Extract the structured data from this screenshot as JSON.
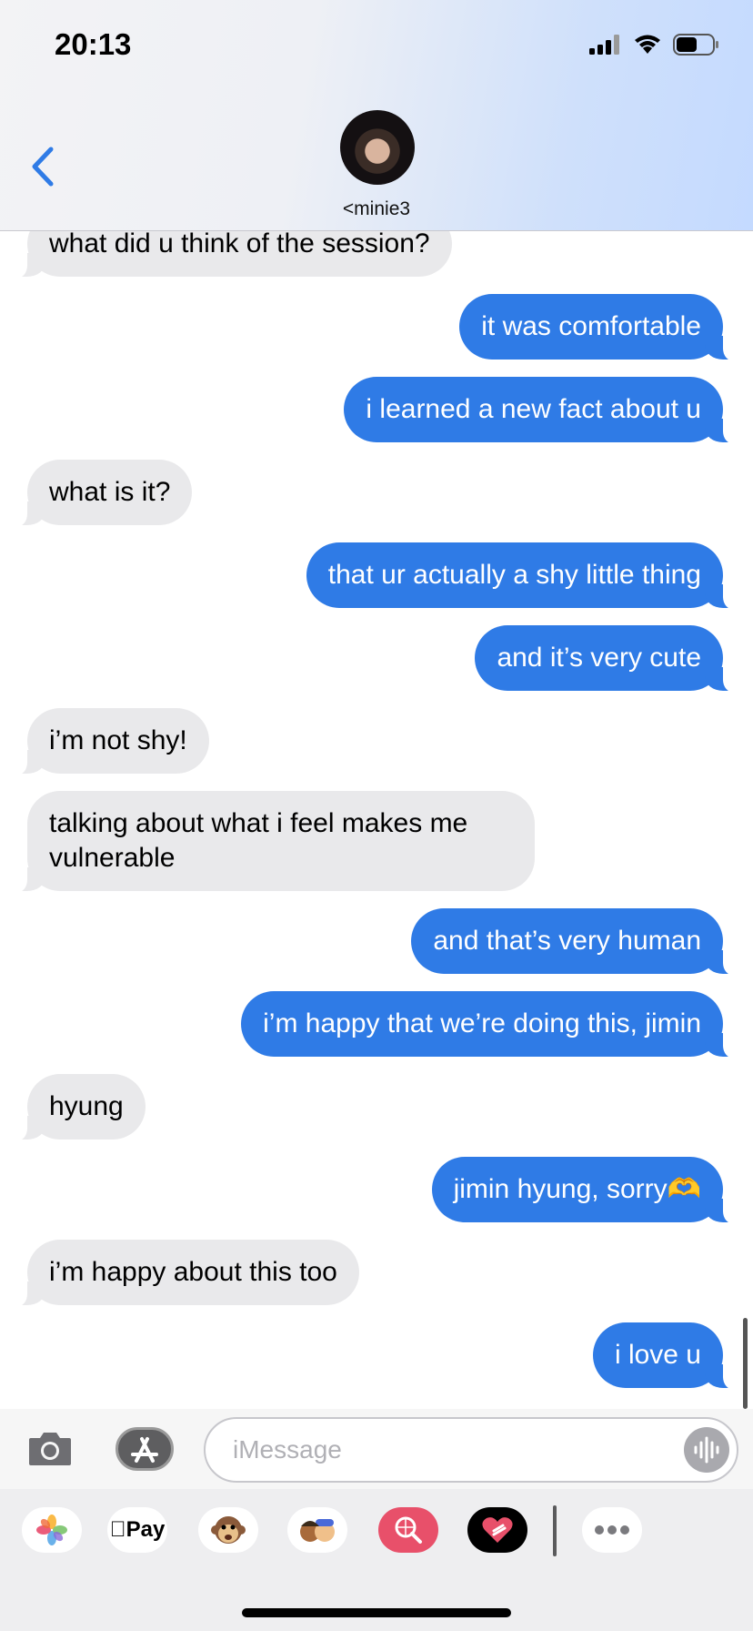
{
  "status_bar": {
    "time": "20:13"
  },
  "header": {
    "contact_name": "<minie3"
  },
  "messages": [
    {
      "side": "in",
      "text": "what did u think of the session?"
    },
    {
      "side": "out",
      "text": "it was comfortable"
    },
    {
      "side": "out",
      "text": "i learned a new fact about u"
    },
    {
      "side": "in",
      "text": "what is it?"
    },
    {
      "side": "out",
      "text": "that ur actually a shy little thing"
    },
    {
      "side": "out",
      "text": "and it’s very cute"
    },
    {
      "side": "in",
      "text": "i’m not shy!"
    },
    {
      "side": "in",
      "text": "talking about what i feel makes me vulnerable"
    },
    {
      "side": "out",
      "text": "and that’s very human"
    },
    {
      "side": "out",
      "text": "i’m happy that we’re doing this, jimin"
    },
    {
      "side": "in",
      "text": "hyung"
    },
    {
      "side": "out",
      "text": "jimin hyung, sorry🫶"
    },
    {
      "side": "in",
      "text": "i’m happy about this too"
    },
    {
      "side": "out",
      "text": "i love u"
    }
  ],
  "compose": {
    "placeholder": "iMessage"
  },
  "app_drawer": {
    "apps": [
      {
        "name": "photos-icon"
      },
      {
        "name": "apple-pay-icon",
        "label": "Pay"
      },
      {
        "name": "monkey-emoji-icon"
      },
      {
        "name": "memoji-icon"
      },
      {
        "name": "web-search-icon"
      },
      {
        "name": "digital-touch-icon"
      },
      {
        "name": "more-icon"
      }
    ]
  },
  "colors": {
    "outgoing": "#2f7be6",
    "incoming": "#e9e9eb",
    "accent": "#2f7be6"
  }
}
